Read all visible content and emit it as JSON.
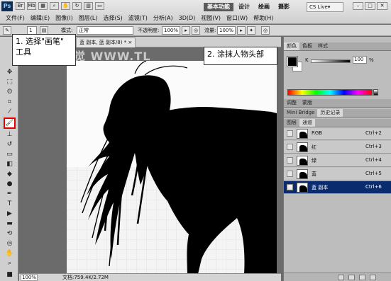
{
  "app": {
    "logo": "Ps"
  },
  "menubar": {
    "items": [
      "文件(F)",
      "编辑(E)",
      "图像(I)",
      "图层(L)",
      "选择(S)",
      "滤镜(T)",
      "分析(A)",
      "3D(D)",
      "视图(V)",
      "窗口(W)",
      "帮助(H)"
    ],
    "workspaces": [
      "基本功能",
      "设计",
      "绘画",
      "摄影"
    ],
    "cslive": "CS Live▾"
  },
  "options": {
    "brush_size": "1",
    "mode_label": "模式:",
    "mode_value": "正常",
    "opacity_label": "不透明度:",
    "opacity_value": "100%",
    "flow_label": "流量:",
    "flow_value": "100%"
  },
  "document": {
    "tab_title": "蓝 副本, 蓝 副本/8) * ×",
    "watermark": "视觉 WWW.TL"
  },
  "callouts": {
    "step1": "1. 选择\"画笔\"\n工具",
    "step2": "2. 涂抹人物头部"
  },
  "status": {
    "zoom": "100%",
    "info": "文档:759.4K/2.72M"
  },
  "panels": {
    "color_tabs": [
      "颜色",
      "色板",
      "样式"
    ],
    "k_label": "K",
    "k_value": "100",
    "k_unit": "%",
    "adjust_tabs": [
      "调整",
      "蒙版"
    ],
    "bridge_tabs": [
      "Mini Bridge",
      "历史记录"
    ],
    "layer_tabs": [
      "图层",
      "通道"
    ],
    "channels": [
      {
        "name": "RGB",
        "shortcut": "Ctrl+2",
        "selected": false
      },
      {
        "name": "红",
        "shortcut": "Ctrl+3",
        "selected": false
      },
      {
        "name": "绿",
        "shortcut": "Ctrl+4",
        "selected": false
      },
      {
        "name": "蓝",
        "shortcut": "Ctrl+5",
        "selected": false
      },
      {
        "name": "蓝 副本",
        "shortcut": "Ctrl+6",
        "selected": true
      }
    ]
  },
  "colors": {
    "selection_red": "#e00000",
    "selected_channel": "#0a2c6e",
    "active_workspace": "#5a5a5a"
  }
}
